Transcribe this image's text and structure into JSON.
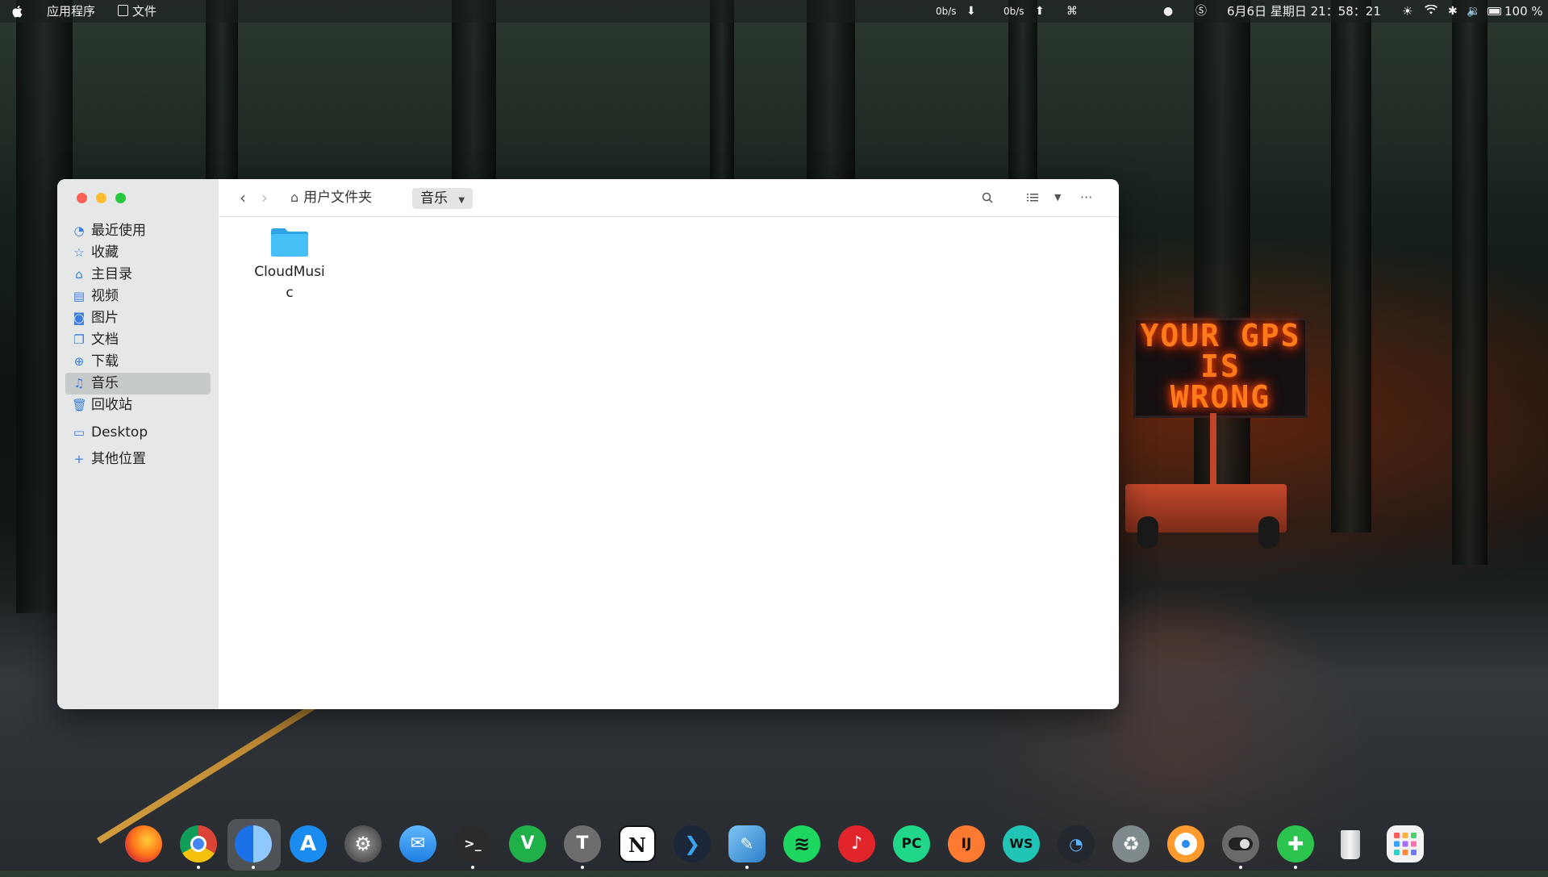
{
  "topbar": {
    "menu_apps": "应用程序",
    "menu_file": "文件",
    "net_down": "0b/s",
    "net_up": "0b/s",
    "datetime": "6月6日 星期日 21：58：21",
    "battery": "100 %"
  },
  "wallpaper_sign": {
    "line1": "YOUR GPS",
    "line2": "IS",
    "line3": "WRONG"
  },
  "sidebar": {
    "items": [
      {
        "label": "最近使用",
        "icon": "clock-icon"
      },
      {
        "label": "收藏",
        "icon": "star-icon"
      },
      {
        "label": "主目录",
        "icon": "home-icon"
      },
      {
        "label": "视频",
        "icon": "film-icon"
      },
      {
        "label": "图片",
        "icon": "camera-icon"
      },
      {
        "label": "文档",
        "icon": "document-icon"
      },
      {
        "label": "下载",
        "icon": "download-icon"
      },
      {
        "label": "音乐",
        "icon": "music-icon"
      },
      {
        "label": "回收站",
        "icon": "trash-icon"
      }
    ],
    "bookmark": "Desktop",
    "other": "其他位置"
  },
  "toolbar": {
    "breadcrumb_home": "用户文件夹",
    "breadcrumb_current": "音乐"
  },
  "files": [
    {
      "name": "CloudMusic",
      "type": "folder"
    }
  ],
  "dock": {
    "apps": [
      "firefox",
      "chrome",
      "finder",
      "app-store",
      "system-preferences",
      "mail",
      "terminal",
      "vim",
      "typora",
      "notion",
      "vscode",
      "sublime",
      "spotify",
      "netease-music",
      "pycharm",
      "intellij",
      "webstorm",
      "activity-monitor",
      "recycle",
      "find-my",
      "toggle-switch",
      "puzzle",
      "trash",
      "launchpad"
    ]
  },
  "colors": {
    "accent": "#3b7ee0",
    "close": "#fe5f57",
    "minimize": "#febc2e",
    "maximize": "#28c840",
    "folder": "#38b6f4"
  }
}
